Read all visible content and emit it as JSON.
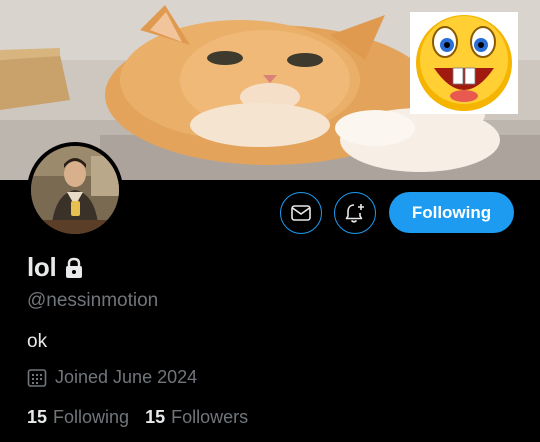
{
  "profile": {
    "display_name": "lol",
    "handle": "@nessinmotion",
    "bio": "ok",
    "joined": "Joined June 2024",
    "protected": true,
    "following_count": "15",
    "following_label": "Following",
    "followers_count": "15",
    "followers_label": "Followers"
  },
  "actions": {
    "message_icon": "envelope-icon",
    "notify_icon": "bell-plus-icon",
    "follow_button_label": "Following"
  },
  "colors": {
    "accent": "#1d9bf0",
    "background": "#000000",
    "secondary_text": "#71767b",
    "primary_text": "#e7e9ea"
  }
}
